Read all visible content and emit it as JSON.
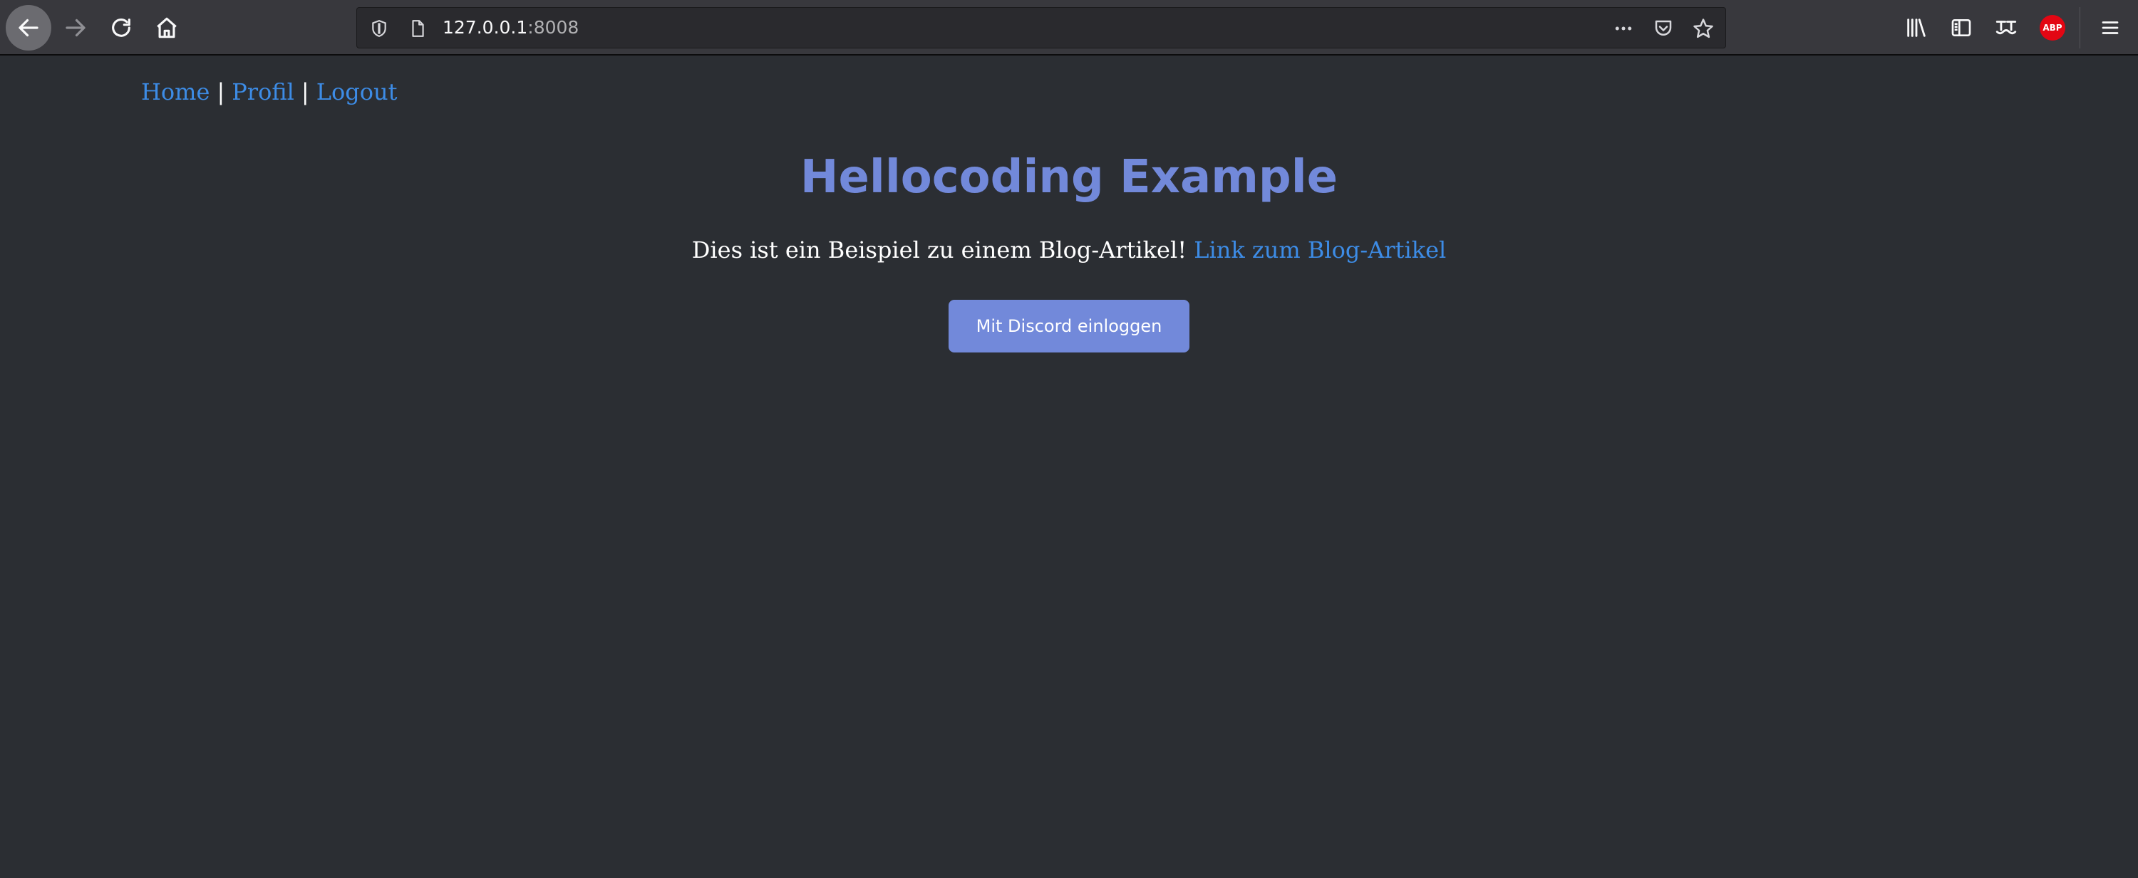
{
  "browser": {
    "url_host": "127.0.0.1",
    "url_port": ":8008",
    "abp_label": "ABP"
  },
  "nav": {
    "home": "Home",
    "profile": "Profil",
    "logout": "Logout",
    "separator": "|"
  },
  "main": {
    "title": "Hellocoding Example",
    "intro_text": "Dies ist ein Beispiel zu einem Blog-Artikel!",
    "blog_link": "Link zum Blog-Artikel",
    "login_button": "Mit Discord einloggen"
  },
  "colors": {
    "accent": "#7289da",
    "link": "#3d8ce6",
    "background": "#2b2e33"
  }
}
